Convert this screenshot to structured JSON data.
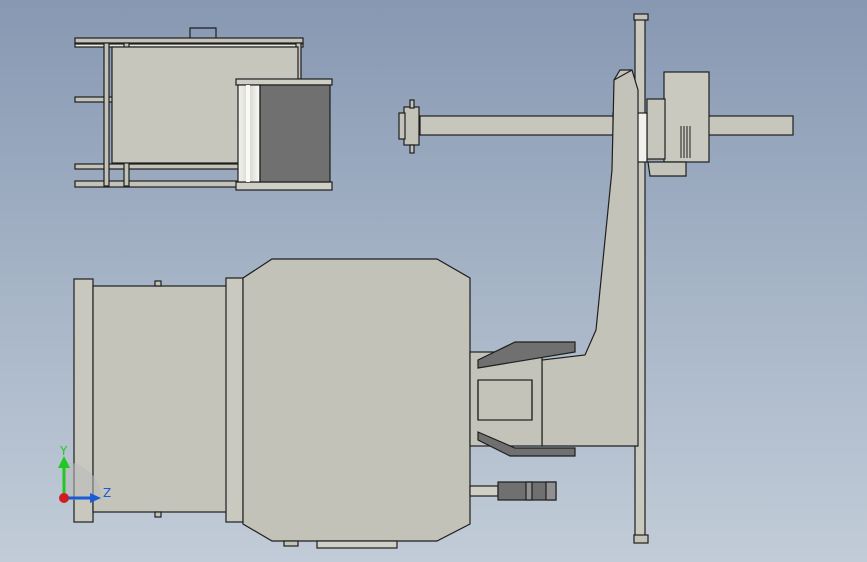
{
  "viewport": {
    "background_top": "#8798b2",
    "background_bottom": "#c2ccd8"
  },
  "model": {
    "fill": "#c3c3b9",
    "fill_dark": "#707070",
    "edge": "#1e1e1e"
  },
  "triad": {
    "y_label": "Y",
    "z_label": "Z",
    "y_color": "#22c822",
    "z_color": "#1a5bd6",
    "origin_color": "#d01e1e"
  }
}
